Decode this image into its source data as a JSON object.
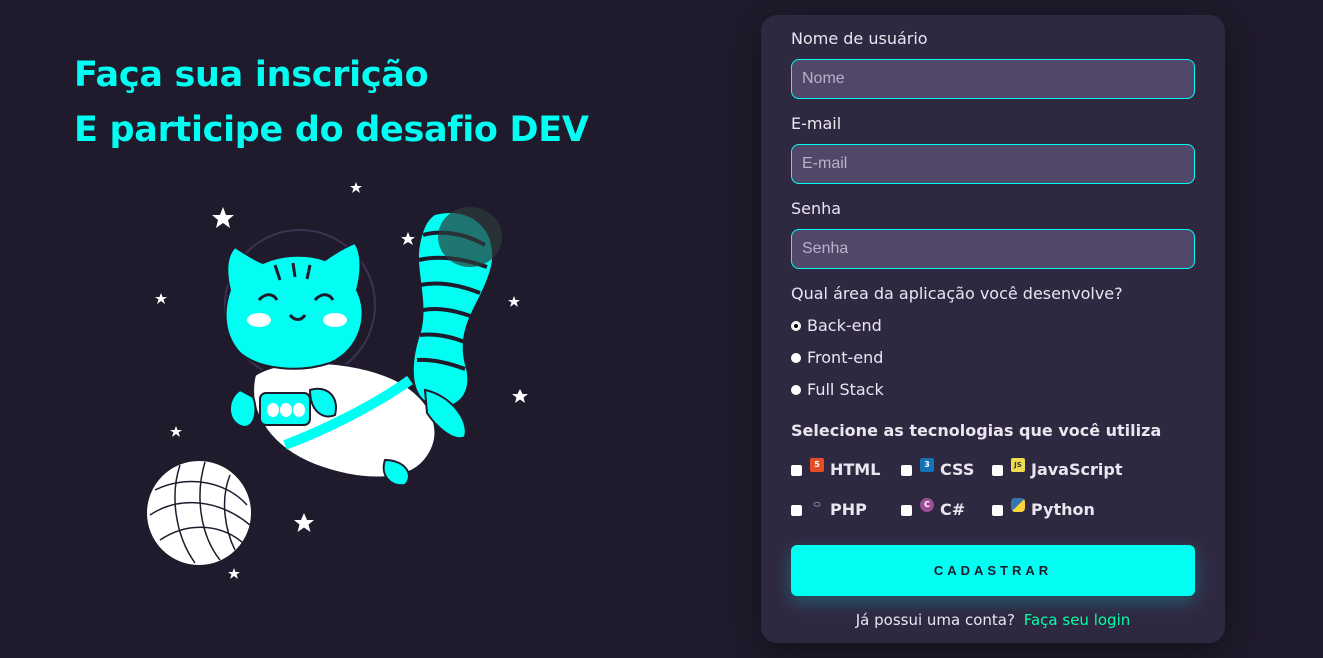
{
  "hero": {
    "line1": "Faça sua inscrição",
    "line2": "E participe do desafio DEV"
  },
  "form": {
    "username": {
      "label": "Nome de usuário",
      "placeholder": "Nome"
    },
    "email": {
      "label": "E-mail",
      "placeholder": "E-mail"
    },
    "password": {
      "label": "Senha",
      "placeholder": "Senha"
    },
    "area_question": "Qual área da aplicação você desenvolve?",
    "areas": [
      {
        "label": "Back-end",
        "selected": true
      },
      {
        "label": "Front-end",
        "selected": false
      },
      {
        "label": "Full Stack",
        "selected": false
      }
    ],
    "tech_title": "Selecione as tecnologias que você utiliza",
    "techs": [
      {
        "label": "HTML",
        "icon": "html5-icon"
      },
      {
        "label": "CSS",
        "icon": "css3-icon"
      },
      {
        "label": "JavaScript",
        "icon": "javascript-icon"
      },
      {
        "label": "PHP",
        "icon": "php-icon"
      },
      {
        "label": "C#",
        "icon": "csharp-icon"
      },
      {
        "label": "Python",
        "icon": "python-icon"
      }
    ],
    "submit": "CADASTRAR",
    "footer_text": "Já possui uma conta?",
    "footer_link": "Faça seu login"
  },
  "colors": {
    "background": "#201b2c",
    "card": "#2f2841",
    "input": "#514869",
    "accent": "#00fff2",
    "link": "#00ffa8"
  }
}
